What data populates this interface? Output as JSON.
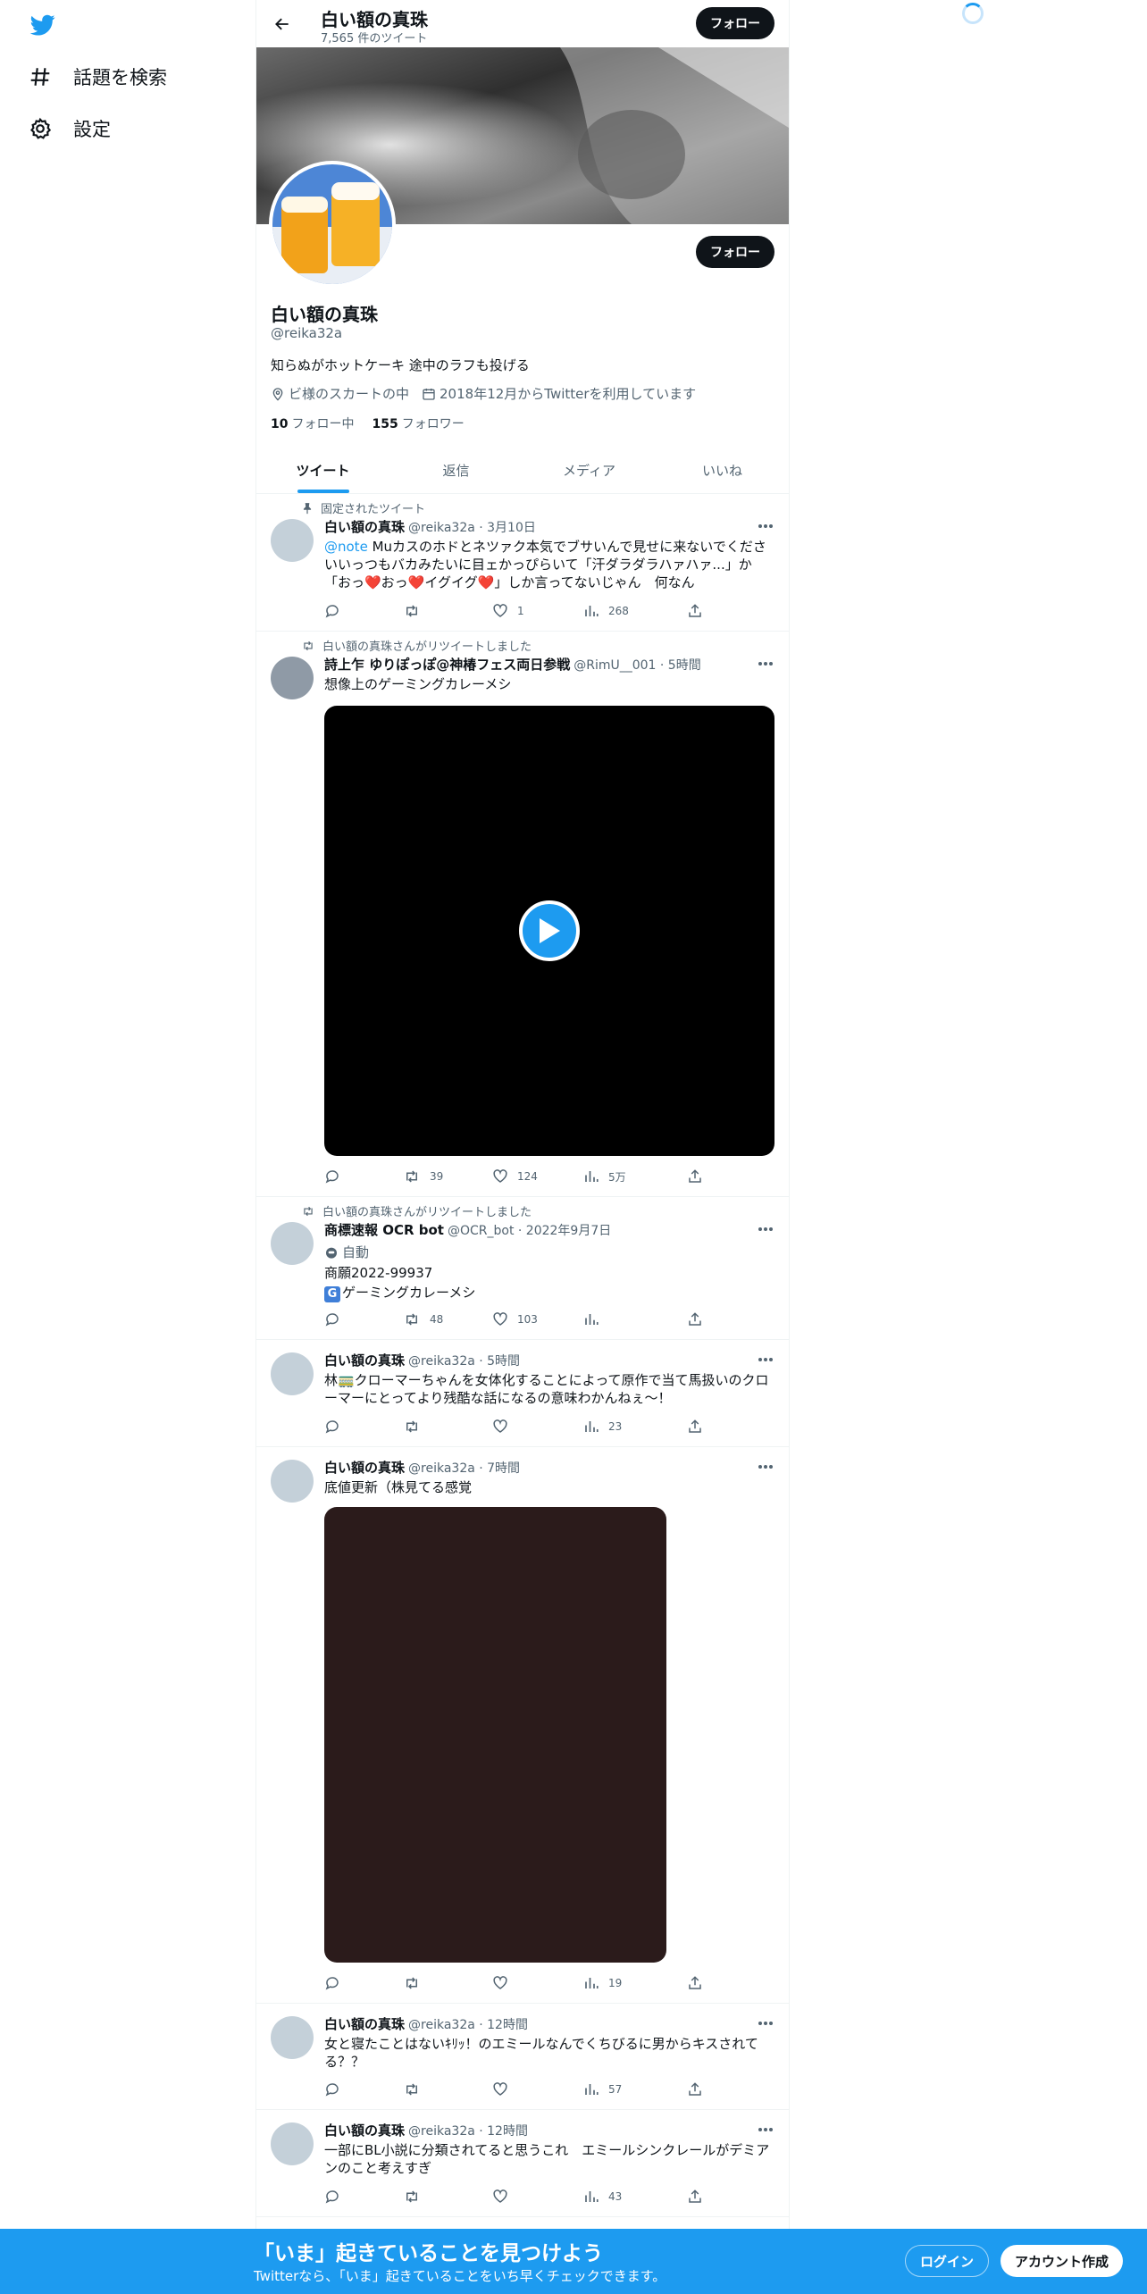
{
  "nav": {
    "items": [
      {
        "label": "話題を検索",
        "icon": "hashtag-icon"
      },
      {
        "label": "設定",
        "icon": "gear-icon"
      }
    ]
  },
  "profile": {
    "name": "白い額の真珠",
    "tweet_count": "7,565 件のツイート",
    "follow_label": "フォロー",
    "handle": "@reika32a",
    "bio": "知らぬがホットケーキ 途中のラフも投げる",
    "location": "ビ様のスカートの中",
    "joined": "2018年12月からTwitterを利用しています",
    "following_count": "10",
    "following_label": "フォロー中",
    "followers_count": "155",
    "followers_label": "フォロワー"
  },
  "tabs": [
    "ツイート",
    "返信",
    "メディア",
    "いいね"
  ],
  "tweets": [
    {
      "context": "固定されたツイート",
      "name": "白い額の真珠",
      "meta": "@reika32a · 3月10日",
      "mention": "@note",
      "text": " Muカスのホドとネツァク本気でブサいんで見せに来ないでくださいいっつもバカみたいに目ェかっぴらいて「汗ダラダラハァハァ...」か「おっ❤️おっ❤️イグイグ❤️」しか言ってないじゃん　何なん",
      "reply": "",
      "retweet": "",
      "like": "1",
      "views": "268"
    },
    {
      "context": "白い額の真珠さんがリツイートしました",
      "name": "詩上乍 ゆりぽっぽ@神椿フェス両日参戦",
      "meta": "@RimU__001 · 5時間",
      "text": "想像上のゲーミングカレーメシ",
      "reply": "",
      "retweet": "39",
      "like": "124",
      "views": "5万"
    },
    {
      "context": "白い額の真珠さんがリツイートしました",
      "name": "商標速報 OCR bot",
      "meta": "@OCR_bot · 2022年9月7日",
      "auto": "自動",
      "line1": "商願2022-99937",
      "badge": "G",
      "line2": "ゲーミングカレーメシ",
      "reply": "",
      "retweet": "48",
      "like": "103",
      "views": ""
    },
    {
      "name": "白い額の真珠",
      "meta": "@reika32a · 5時間",
      "text": "林🚃クローマーちゃんを女体化することによって原作で当て馬扱いのクローマーにとってより残酷な話になるの意味わかんねぇ～！",
      "reply": "",
      "retweet": "",
      "like": "",
      "views": "23"
    },
    {
      "name": "白い額の真珠",
      "meta": "@reika32a · 7時間",
      "text": "底値更新（株見てる感覚",
      "reply": "",
      "retweet": "",
      "like": "",
      "views": "19"
    },
    {
      "name": "白い額の真珠",
      "meta": "@reika32a · 12時間",
      "text": "女と寝たことはないｷﾘｯ！のエミールなんでくちびるに男からキスされてる？？",
      "reply": "",
      "retweet": "",
      "like": "",
      "views": "57"
    },
    {
      "name": "白い額の真珠",
      "meta": "@reika32a · 12時間",
      "text": "一部にBL小説に分類されてると思うこれ　エミールシンクレールがデミアンのこと考えすぎ",
      "reply": "",
      "retweet": "",
      "like": "",
      "views": "43"
    }
  ],
  "bottom": {
    "title": "「いま」起きていることを見つけよう",
    "subtitle": "Twitterなら、「いま」起きていることをいち早くチェックできます。",
    "login": "ログイン",
    "signup": "アカウント作成"
  },
  "colors": {
    "accent": "#1d9bf0",
    "text": "#0f1419",
    "muted": "#536471"
  }
}
